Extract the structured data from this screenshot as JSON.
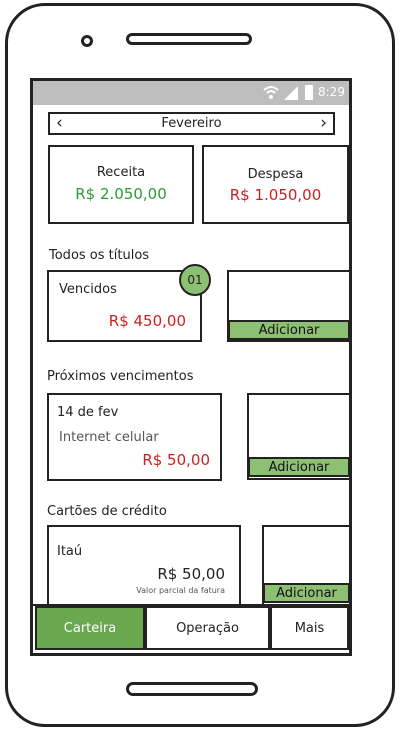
{
  "status_bar": {
    "time": "8:29"
  },
  "month_nav": {
    "prev": "<",
    "month": "Fevereiro",
    "next": ">"
  },
  "summary": {
    "receita_label": "Receita",
    "receita_value": "R$ 2.050,00",
    "despesa_label": "Despesa",
    "despesa_value": "R$ 1.050,00"
  },
  "titulos": {
    "section_title": "Todos os títulos",
    "card_label": "Vencidos",
    "badge": "01",
    "amount": "R$ 450,00",
    "add_label": "Adicionar"
  },
  "vencimentos": {
    "section_title": "Próximos vencimentos",
    "date": "14 de fev",
    "description": "Internet celular",
    "amount": "R$ 50,00",
    "add_label": "Adicionar"
  },
  "cartoes": {
    "section_title": "Cartões de crédito",
    "bank": "Itaú",
    "amount": "R$ 50,00",
    "caption": "Valor parcial da fatura",
    "add_label": "Adicionar"
  },
  "bottom_nav": {
    "carteira": "Carteira",
    "operacao": "Operação",
    "mais": "Mais"
  },
  "colors": {
    "accent_green": "#6aa84f",
    "button_green": "#8ec074",
    "income": "#2e9b34",
    "expense": "#cc1f1f"
  }
}
